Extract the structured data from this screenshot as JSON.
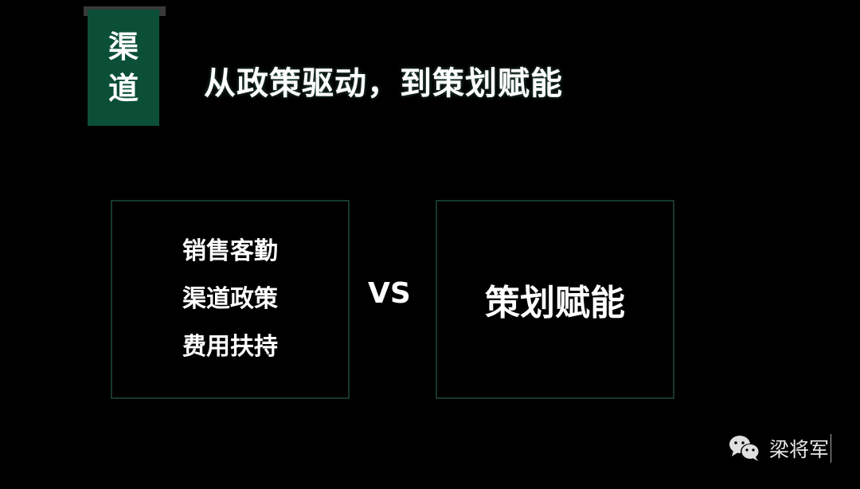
{
  "section_tag": {
    "chars": [
      "渠",
      "道"
    ],
    "color": "#0b4f37"
  },
  "title": "从政策驱动，到策划赋能",
  "left_box": {
    "items": [
      "销售客勤",
      "渠道政策",
      "费用扶持"
    ]
  },
  "vs_label": "VS",
  "right_box": {
    "label": "策划赋能"
  },
  "watermark": {
    "icon": "wechat-icon",
    "name": "梁将军"
  }
}
